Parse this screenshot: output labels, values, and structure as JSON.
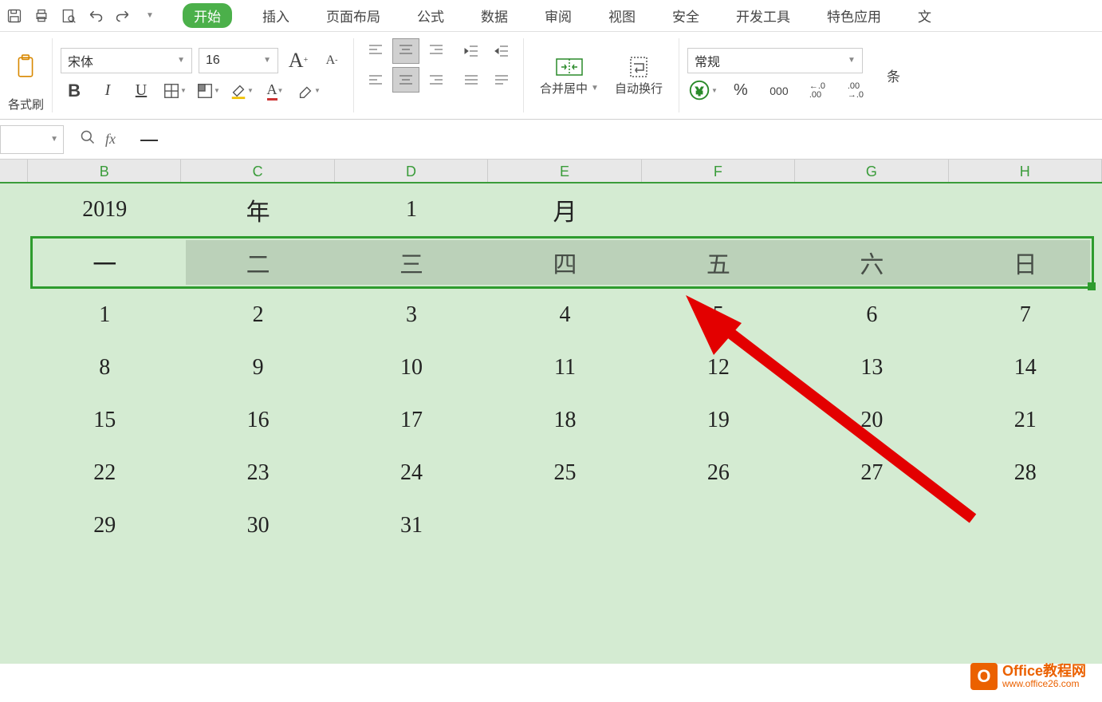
{
  "menu": {
    "tabs": [
      "开始",
      "插入",
      "页面布局",
      "公式",
      "数据",
      "审阅",
      "视图",
      "安全",
      "开发工具",
      "特色应用",
      "文"
    ],
    "active_index": 0
  },
  "ribbon": {
    "format_brush": "各式刷",
    "font_name": "宋体",
    "font_size": "16",
    "bold": "B",
    "italic": "I",
    "underline": "U",
    "big_a": "A⁺",
    "small_a": "A⁻",
    "merge_center": "合并居中",
    "auto_wrap": "自动换行",
    "number_format": "常规",
    "percent": "%",
    "thousands": "000",
    "dec_inc": ".0→.00",
    "dec_dec": ".00→.0",
    "cond": "条"
  },
  "formula_bar": {
    "fx": "fx",
    "value": "一"
  },
  "columns": [
    "B",
    "C",
    "D",
    "E",
    "F",
    "G",
    "H"
  ],
  "grid": {
    "row1": [
      "2019",
      "年",
      "1",
      "月",
      "",
      "",
      ""
    ],
    "row2": [
      "一",
      "二",
      "三",
      "四",
      "五",
      "六",
      "日"
    ],
    "row3": [
      "1",
      "2",
      "3",
      "4",
      "5",
      "6",
      "7"
    ],
    "row4": [
      "8",
      "9",
      "10",
      "11",
      "12",
      "13",
      "14"
    ],
    "row5": [
      "15",
      "16",
      "17",
      "18",
      "19",
      "20",
      "21"
    ],
    "row6": [
      "22",
      "23",
      "24",
      "25",
      "26",
      "27",
      "28"
    ],
    "row7": [
      "29",
      "30",
      "31",
      "",
      "",
      "",
      ""
    ]
  },
  "watermark": {
    "icon": "O",
    "title": "Office教程网",
    "url": "www.office26.com"
  }
}
